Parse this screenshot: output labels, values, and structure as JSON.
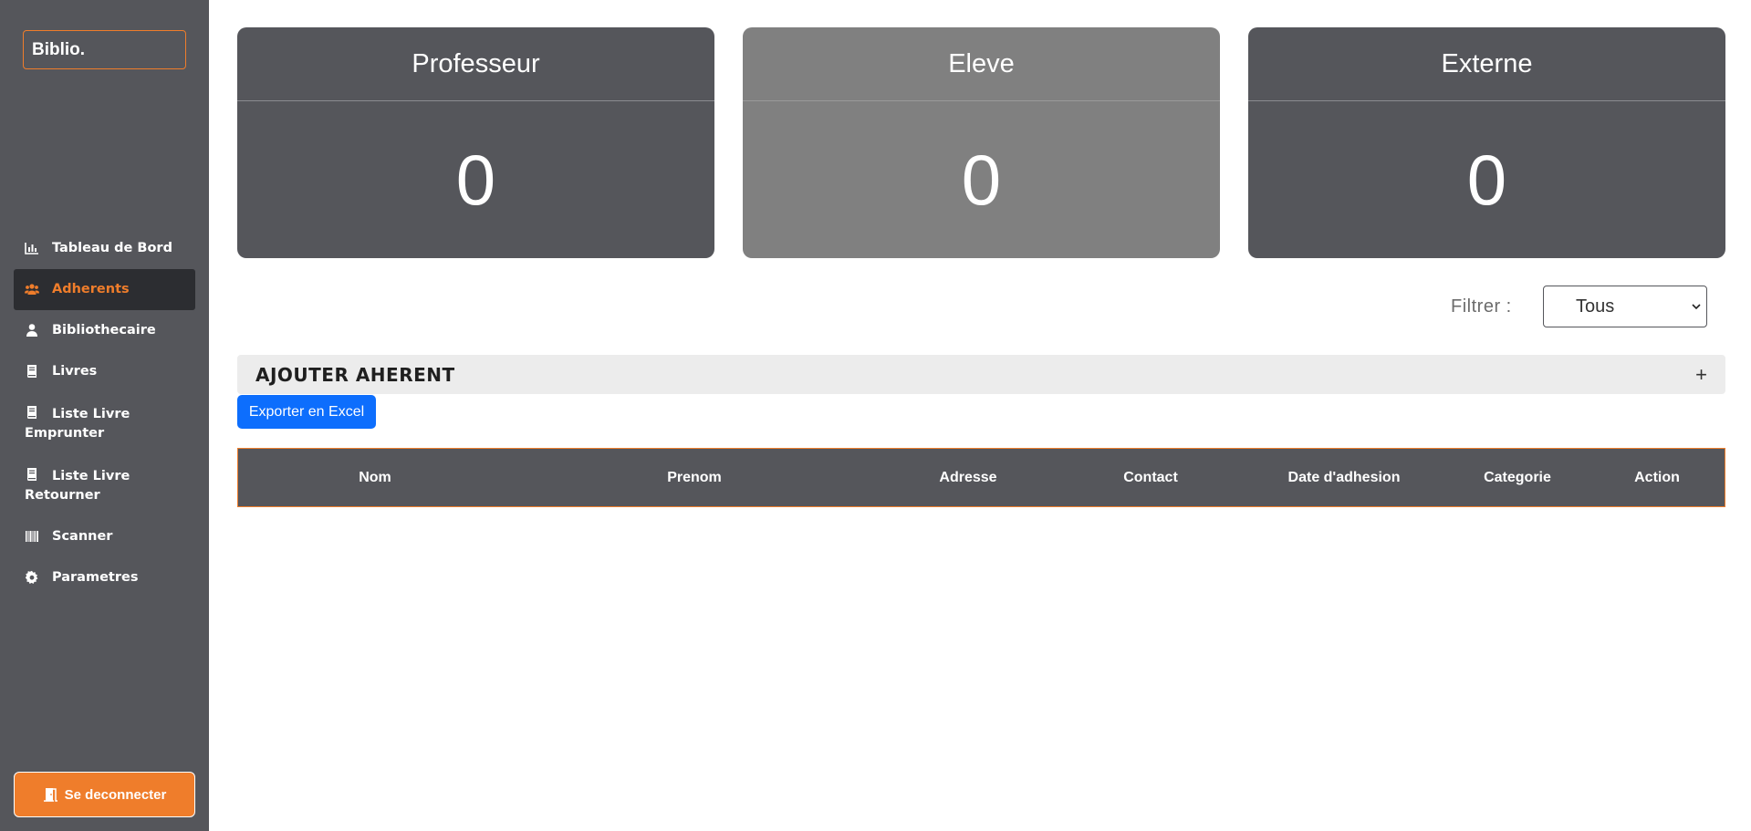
{
  "sidebar": {
    "logo": "Biblio.",
    "items": [
      {
        "label": "Tableau de Bord",
        "icon": "chart-bar-icon"
      },
      {
        "label": "Adherents",
        "icon": "users-icon",
        "active": true
      },
      {
        "label": "Bibliothecaire",
        "icon": "user-icon"
      },
      {
        "label": "Livres",
        "icon": "book-icon"
      },
      {
        "label_line1": "Liste Livre",
        "label_line2": "Emprunter",
        "icon": "book-icon"
      },
      {
        "label_line1": "Liste Livre",
        "label_line2": "Retourner",
        "icon": "book-icon"
      },
      {
        "label": "Scanner",
        "icon": "barcode-icon"
      },
      {
        "label": "Parametres",
        "icon": "gear-icon"
      }
    ],
    "logout_label": "Se deconnecter"
  },
  "cards": [
    {
      "title": "Professeur",
      "value": "0"
    },
    {
      "title": "Eleve",
      "value": "0"
    },
    {
      "title": "Externe",
      "value": "0"
    }
  ],
  "filter": {
    "label": "Filtrer :",
    "selected": "Tous"
  },
  "accordion": {
    "title": "AJOUTER AHERENT",
    "toggle": "+"
  },
  "export_label": "Exporter en Excel",
  "table": {
    "columns": [
      "Nom",
      "Prenom",
      "Adresse",
      "Contact",
      "Date d'adhesion",
      "Categorie",
      "Action"
    ]
  },
  "colors": {
    "sidebar": "#55565b",
    "accent": "#ef7d2b",
    "active_bg": "#2c2d31",
    "card_light": "#808080",
    "primary_button": "#0d6efd"
  }
}
